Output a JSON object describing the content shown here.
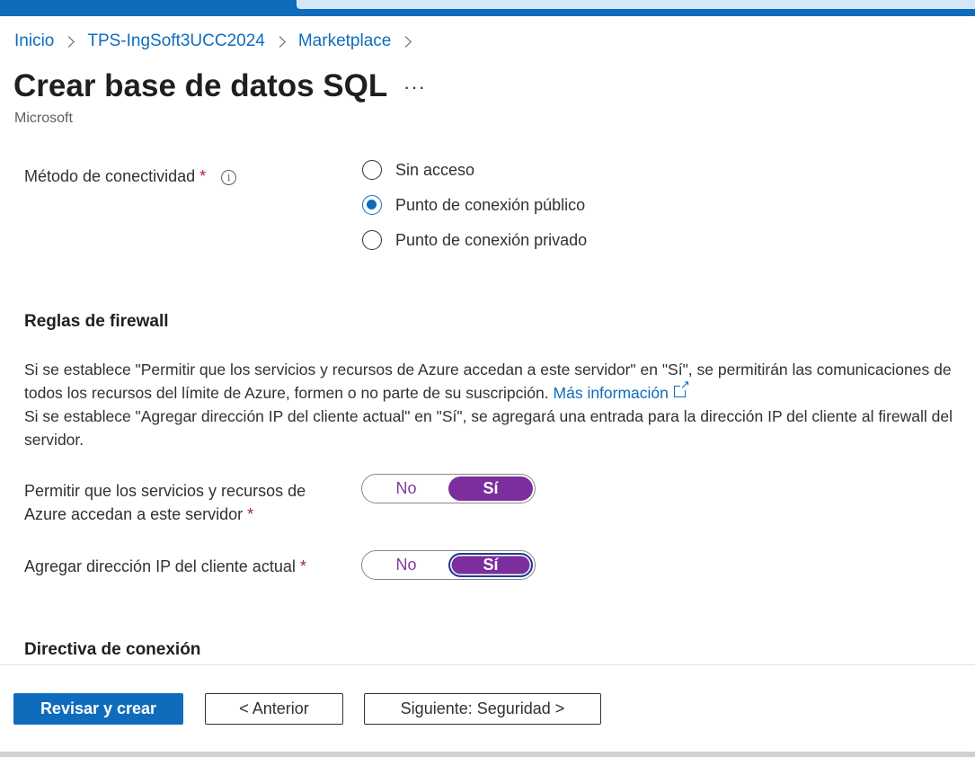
{
  "breadcrumb": [
    "Inicio",
    "TPS-IngSoft3UCC2024",
    "Marketplace"
  ],
  "page": {
    "title": "Crear base de datos SQL",
    "more": "···",
    "subtitle": "Microsoft"
  },
  "connectivity": {
    "label": "Método de conectividad",
    "required": "*",
    "info": "i",
    "options": [
      "Sin acceso",
      "Punto de conexión público",
      "Punto de conexión privado"
    ],
    "selected": "Punto de conexión público"
  },
  "firewall": {
    "title": "Reglas de firewall",
    "para1": "Si se establece \"Permitir que los servicios y recursos de Azure accedan a este servidor\" en \"Sí\", se permitirán las comunicaciones de todos los recursos del límite de Azure, formen o no parte de su suscripción.",
    "link": "Más información",
    "para2": "Si se establece \"Agregar dirección IP del cliente actual\" en \"Sí\", se agregará una entrada para la dirección IP del cliente al firewall del servidor.",
    "allow_azure": {
      "label_line1": "Permitir que los servicios y recursos de",
      "label_line2": "Azure accedan a este servidor",
      "required": "*",
      "no": "No",
      "yes": "Sí",
      "value": "Sí"
    },
    "add_ip": {
      "label": "Agregar dirección IP del cliente actual",
      "required": "*",
      "no": "No",
      "yes": "Sí",
      "value": "Sí"
    }
  },
  "connection_policy": {
    "title": "Directiva de conexión"
  },
  "footer": {
    "review": "Revisar y crear",
    "previous": "< Anterior",
    "next": "Siguiente: Seguridad >"
  },
  "colors": {
    "accent": "#0f6cbd",
    "toggle_on": "#7c2e9e",
    "required": "#a4262c"
  }
}
